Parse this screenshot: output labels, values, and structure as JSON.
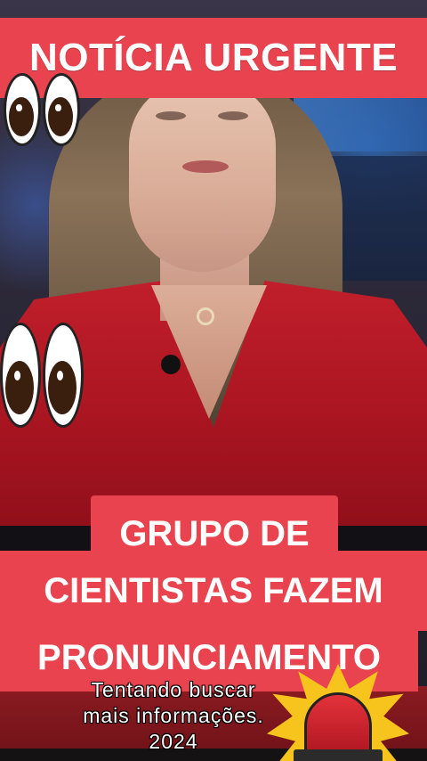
{
  "banner_top": {
    "text": "NOTÍCIA URGENTE"
  },
  "headline": {
    "line1": "GRUPO DE",
    "line2": "CIENTISTAS FAZEM",
    "line3": "PRONUNCIAMENTO"
  },
  "caption": {
    "line1": "Tentando buscar",
    "line2": "mais informações.",
    "line3": "2024"
  },
  "stickers": [
    "eyes-emoji",
    "eyes-emoji",
    "police-siren-emoji"
  ],
  "colors": {
    "banner": "#e8434e",
    "dress": "#c2202c",
    "siren_burst": "#f7c31d"
  }
}
